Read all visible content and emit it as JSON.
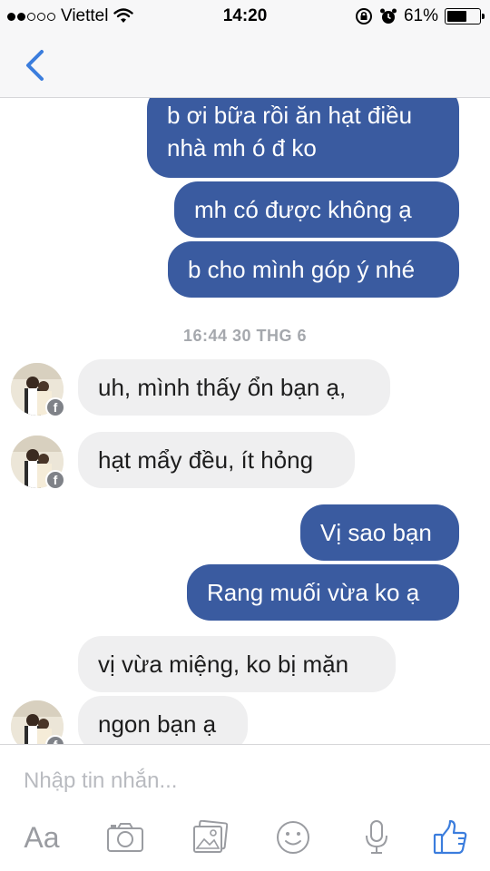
{
  "status_bar": {
    "carrier": "Viettel",
    "time": "14:20",
    "battery_percent": "61%",
    "battery_level": 0.61,
    "signal_bars_filled": 2,
    "signal_bars_total": 5
  },
  "nav": {
    "back_icon": "chevron-left-icon",
    "accent_color": "#3b7ddd"
  },
  "messages": [
    {
      "direction": "outgoing",
      "lines": [
        "b ơi bữa rồi ăn hạt điều",
        "nhà mh ó đ ko"
      ]
    },
    {
      "direction": "outgoing",
      "text": "mh có được không ạ"
    },
    {
      "direction": "outgoing",
      "text": "b cho mình góp ý nhé"
    },
    {
      "type": "timestamp",
      "text": "16:44 30 THG 6"
    },
    {
      "direction": "incoming",
      "text": "uh, mình thấy ổn bạn ạ,"
    },
    {
      "direction": "incoming",
      "text": "hạt mẩy đều, ít hỏng"
    },
    {
      "direction": "outgoing",
      "text": "Vị sao bạn"
    },
    {
      "direction": "outgoing",
      "text": "Rang muối vừa ko ạ"
    },
    {
      "direction": "incoming",
      "text": "vị vừa miệng, ko bị mặn"
    },
    {
      "direction": "incoming",
      "text": "ngon bạn ạ"
    }
  ],
  "composer": {
    "placeholder": "Nhập tin nhắn...",
    "text_format_label": "Aa",
    "tools": [
      "text-format-icon",
      "camera-icon",
      "photo-gallery-icon",
      "emoji-icon",
      "microphone-icon",
      "thumbs-up-icon"
    ]
  },
  "colors": {
    "outgoing_bubble": "#3a5ba0",
    "incoming_bubble": "#efeff0",
    "like_button": "#3b7ddd"
  }
}
